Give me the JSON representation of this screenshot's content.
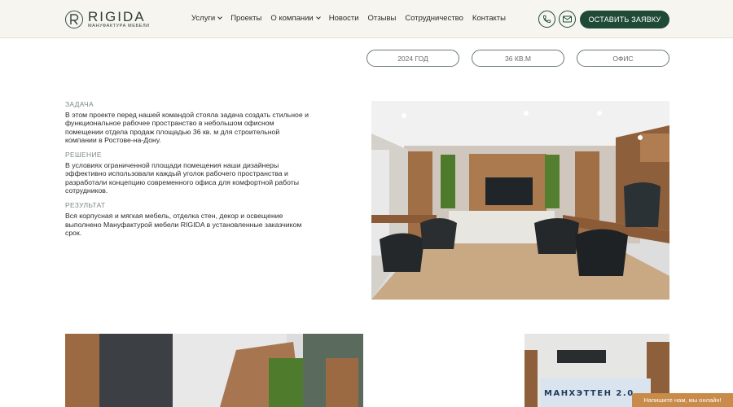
{
  "header": {
    "logo": {
      "name": "RIGIDA",
      "subtitle": "МАНУФАКТУРА МЕБЕЛИ"
    },
    "nav": [
      {
        "label": "Услуги",
        "dropdown": true
      },
      {
        "label": "Проекты",
        "dropdown": false
      },
      {
        "label": "О компании",
        "dropdown": true
      },
      {
        "label": "Новости",
        "dropdown": false
      },
      {
        "label": "Отзывы",
        "dropdown": false
      },
      {
        "label": "Сотрудничество",
        "dropdown": false
      },
      {
        "label": "Контакты",
        "dropdown": false
      }
    ],
    "phone_icon": "phone-icon",
    "mail_icon": "mail-icon",
    "cta_label": "ОСТАВИТЬ ЗАЯВКУ"
  },
  "tags": {
    "year": "2024 ГОД",
    "area": "36 КВ.М",
    "type": "ОФИС"
  },
  "project": {
    "task_title": "ЗАДАЧА",
    "task_text": "В этом проекте перед нашей командой стояла задача создать стильное и функциональное рабочее пространство в небольшом офисном помещении отдела продаж площадью 36 кв. м для строительной компании в Ростове-на-Дону.",
    "solution_title": "РЕШЕНИЕ",
    "solution_text": "В условиях ограниченной площади помещения наши дизайнеры эффективно использовали каждый уголок рабочего пространства и разработали концепцию современного офиса для комфортной работы сотрудников.",
    "result_title": "РЕЗУЛЬТАТ",
    "result_text": "Вся корпусная и мягкая мебель, отделка стен, декор и освещение выполнено Мануфактурой мебели RIGIDA в установленные заказчиком срок."
  },
  "gallery": {
    "sign_text": "МАНХЭТТЕН 2.0"
  },
  "chat_widget": {
    "label": "Напишите нам, мы онлайн!"
  },
  "colors": {
    "accent": "#1f4a37",
    "header_bg": "#f7f5ef",
    "chat": "#c88b4a"
  }
}
